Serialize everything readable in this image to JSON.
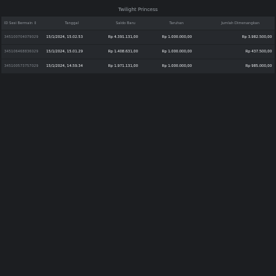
{
  "title": "Twilight Princess",
  "columns": [
    "ID Sesi Bermain ⇕",
    "Tanggal",
    "Saldo Baru",
    "Taruhan",
    "Jumlah Dimenangkan"
  ],
  "rows": [
    [
      "345100704079029",
      "15/1/2024, 15.02.53",
      "Rp 4.391.131,00",
      "Rp 1.000.000,00",
      "Rp 3.982.500,00"
    ],
    [
      "345106468836029",
      "15/1/2024, 15.01.29",
      "Rp 1.408.631,00",
      "Rp 1.000.000,00",
      "Rp 437.500,00"
    ],
    [
      "345100573757029",
      "15/1/2024, 14.59.34",
      "Rp 1.971.131,00",
      "Rp 1.000.000,00",
      "Rp 985.000,00"
    ]
  ]
}
